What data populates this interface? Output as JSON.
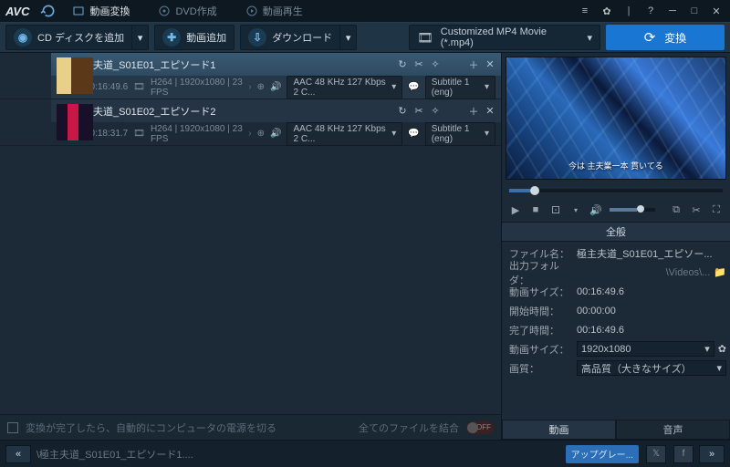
{
  "app": {
    "logo": "AVC"
  },
  "tabs": {
    "convert": "動画変換",
    "dvd": "DVD作成",
    "play": "動画再生"
  },
  "toolbar": {
    "add_disc": "CD ディスクを追加",
    "add_video": "動画追加",
    "download": "ダウンロード",
    "format": "Customized MP4 Movie (*.mp4)",
    "convert": "変換"
  },
  "items": [
    {
      "title": "極主夫道_S01E01_エピソード1",
      "dur": "00:16:49.6",
      "info": "H264 | 1920x1080 | 23 FPS",
      "audio": "AAC 48 KHz 127 Kbps 2 C...",
      "sub": "Subtitle 1 (eng)",
      "thumb_colors": [
        "#e8d088",
        "#5a3818"
      ]
    },
    {
      "title": "極主夫道_S01E02_エピソード2",
      "dur": "00:18:31.7",
      "info": "H264 | 1920x1080 | 23 FPS",
      "audio": "AAC 48 KHz 127 Kbps 2 C...",
      "sub": "Subtitle 1 (eng)",
      "thumb_colors": [
        "#c81848",
        "#181028"
      ]
    }
  ],
  "list_footer": {
    "shutdown": "変換が完了したら、自動的にコンピュータの電源を切る",
    "merge": "全てのファイルを結合",
    "switch": "OFF"
  },
  "preview": {
    "subtitle": "今は 主夫業一本 貫いてる"
  },
  "props": {
    "general": "全般",
    "filename_l": "ファイル名：",
    "filename_v": "極主夫道_S01E01_エピソー...",
    "outfolder_l": "出力フォルダ：",
    "outfolder_v": "\\Videos\\...",
    "size_l": "動画サイズ：",
    "size_v": "00:16:49.6",
    "start_l": "開始時間：",
    "start_v": "00:00:00",
    "end_l": "完了時間：",
    "end_v": "00:16:49.6",
    "dim_l": "動画サイズ：",
    "dim_v": "1920x1080",
    "quality_l": "画質：",
    "quality_v": "高品質（大きなサイズ）"
  },
  "avtabs": {
    "video": "動画",
    "audio": "音声"
  },
  "status": {
    "path": "\\極主夫道_S01E01_エピソード1....",
    "upgrade": "アップグレー..."
  }
}
